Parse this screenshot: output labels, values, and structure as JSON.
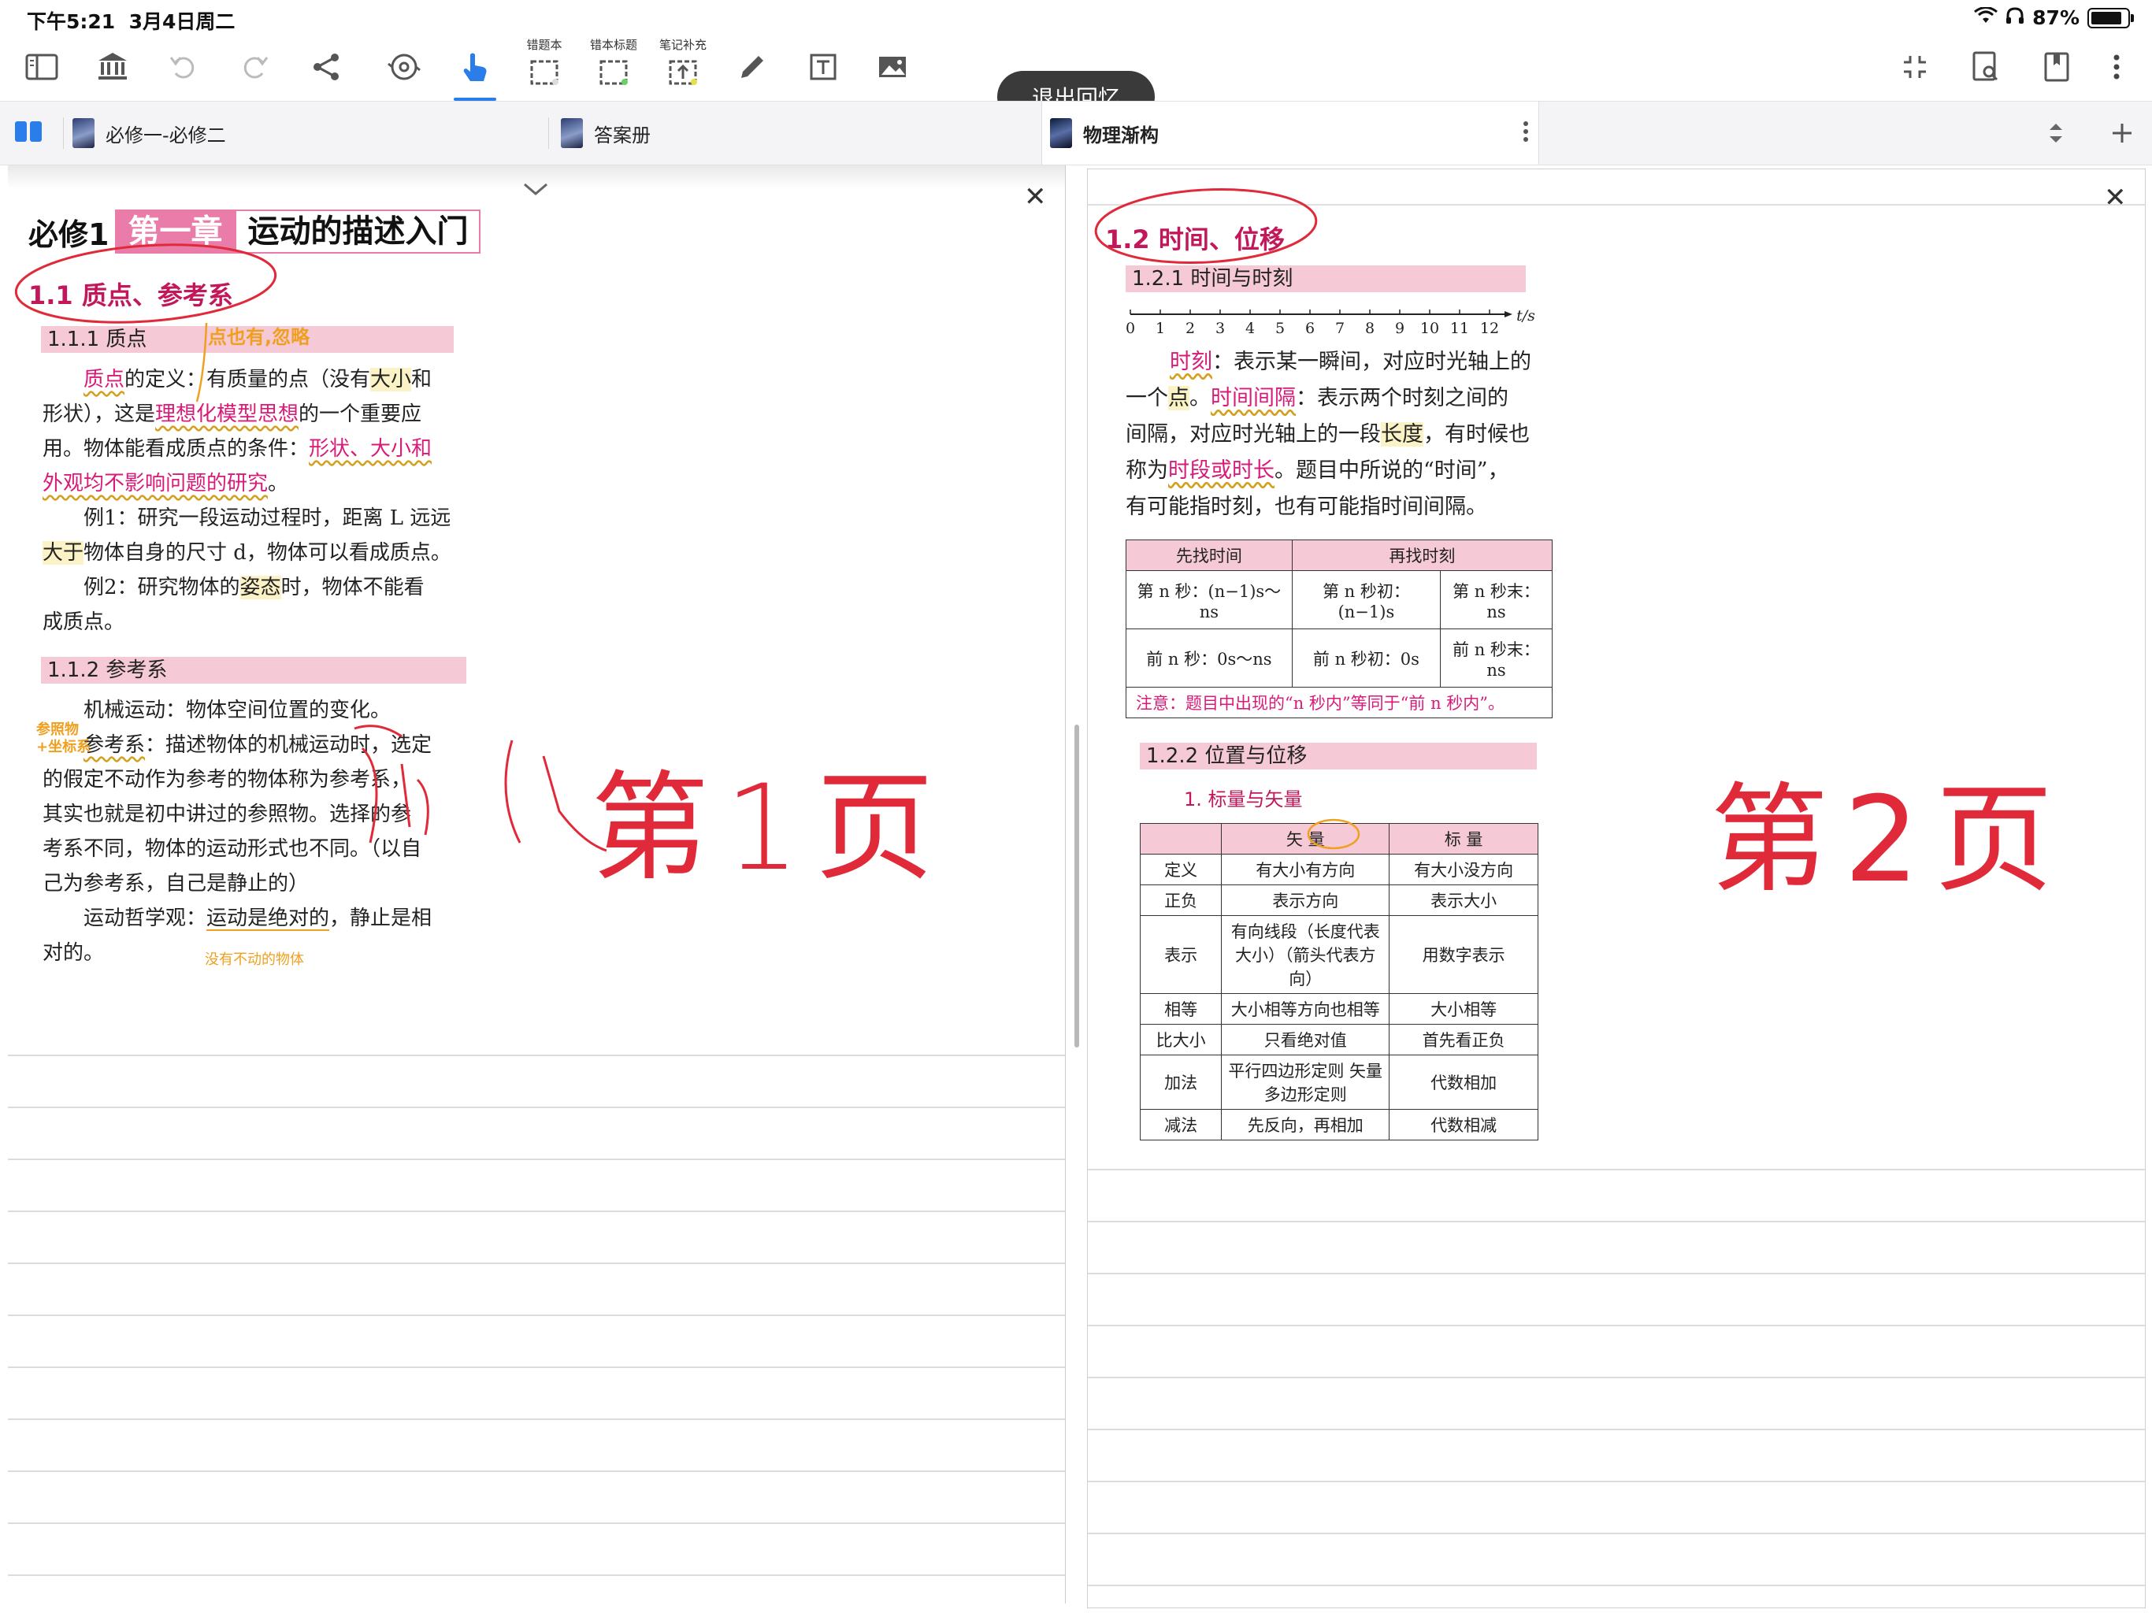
{
  "status": {
    "time": "下午5:21",
    "date": "3月4日周二",
    "battery_pct": "87%"
  },
  "toolbar": {
    "exit_label": "退出回忆",
    "cap_mistakes": "错题本",
    "cap_mistake_title": "错本标题",
    "cap_note_add": "笔记补充"
  },
  "tabs": [
    {
      "label": "必修一-必修二"
    },
    {
      "label": "答案册"
    },
    {
      "label": "物理渐构"
    }
  ],
  "left": {
    "banner_prefix": "必修1",
    "banner_chapter": "第一章",
    "banner_title": "运动的描述入门",
    "section_title": "1.1  质点、参考系",
    "sub1": "1.1.1   质点",
    "p1_a": "质点",
    "p1_b": "的定义：有质量的点（没有",
    "p1_c": "大小",
    "p1_d": "和",
    "p2_a": "形状），这是",
    "p2_b": "理想化模型思想",
    "p2_c": "的一个重要应",
    "p3_a": "用。物体能看成质点的条件：",
    "p3_b": "形状、大小和",
    "p4_a": "外观均不影响问题的研究",
    "p4_b": "。",
    "ex1_a": "例1：研究一段运动过程时，距离 L 远远",
    "ex1_b": "大于",
    "ex1_c": "物体自身的尺寸 d，物体可以看成质点。",
    "ex2_a": "例2：研究物体的",
    "ex2_b": "姿态",
    "ex2_c": "时，物体不能看",
    "ex2_d": "成质点。",
    "sub2": "1.1.2   参考系",
    "r1": "机械运动：物体空间位置的变化。",
    "r2_a": "参考系",
    "r2_b": "：描述物体的机械运动时，选定",
    "r3": "的假定不动作为参考的物体称为参考系，",
    "r4": "其实也就是初中讲过的参照物。选择的参",
    "r5": "考系不同，物体的运动形式也不同。（以自",
    "r6": "己为参考系，自己是静止的）",
    "r7_a": "运动哲学观：",
    "r7_b": "运动是绝对的",
    "r7_c": "，静止是相",
    "r8": "对的。",
    "note_orange1": "点也有,忽略",
    "note_orange2a": "参照物",
    "note_orange2b": "+坐标系",
    "note_orange3": "没有不动的物体",
    "hand_page": "第1页"
  },
  "right": {
    "section_title": "1.2  时间、位移",
    "sub1": "1.2.1   时间与时刻",
    "axis_ticks": [
      "0",
      "1",
      "2",
      "3",
      "4",
      "5",
      "6",
      "7",
      "8",
      "9",
      "10",
      "11",
      "12"
    ],
    "axis_unit": "t/s",
    "q1_a": "时刻",
    "q1_b": "：表示某一瞬间，对应时光轴上的",
    "q2_a": "一个",
    "q2_b": "点",
    "q2_c": "。",
    "q2_d": "时间间隔",
    "q2_e": "：表示两个时刻之间的",
    "q3_a": "间隔，对应时光轴上的一段",
    "q3_b": "长度",
    "q3_c": "，有时候也",
    "q4_a": "称为",
    "q4_b": "时段或时长",
    "q4_c": "。题目中所说的“时间”，",
    "q5": "有可能指时刻，也有可能指时间间隔。",
    "t1_h1": "先找时间",
    "t1_h2": "再找时刻",
    "t1_r1c1": "第 n 秒：(n−1)s～ns",
    "t1_r1c2": "第 n 秒初：(n−1)s",
    "t1_r1c3": "第 n 秒末：ns",
    "t1_r2c1": "前 n 秒：0s～ns",
    "t1_r2c2": "前 n 秒初：0s",
    "t1_r2c3": "前 n 秒末：ns",
    "t1_note": "注意：题目中出现的“n 秒内”等同于“前 n 秒内”。",
    "sub2": "1.2.2   位置与位移",
    "sub2_item": "1. 标量与矢量",
    "t2_h": [
      "",
      "矢 量",
      "标 量"
    ],
    "t2_rows": [
      [
        "定义",
        "有大小有方向",
        "有大小没方向"
      ],
      [
        "正负",
        "表示方向",
        "表示大小"
      ],
      [
        "表示",
        "有向线段（长度代表大小）（箭头代表方向）",
        "用数字表示"
      ],
      [
        "相等",
        "大小相等方向也相等",
        "大小相等"
      ],
      [
        "比大小",
        "只看绝对值",
        "首先看正负"
      ],
      [
        "加法",
        "平行四边形定则 矢量多边形定则",
        "代数相加"
      ],
      [
        "减法",
        "先反向，再相加",
        "代数相减"
      ]
    ],
    "hand_page": "第2页"
  },
  "colors": {
    "accent": "#2b7de9",
    "pink": "#d81b78",
    "pink_bg": "#f5c9d6",
    "ink_red": "#e02a3a",
    "ink_orange": "#f0a020"
  }
}
